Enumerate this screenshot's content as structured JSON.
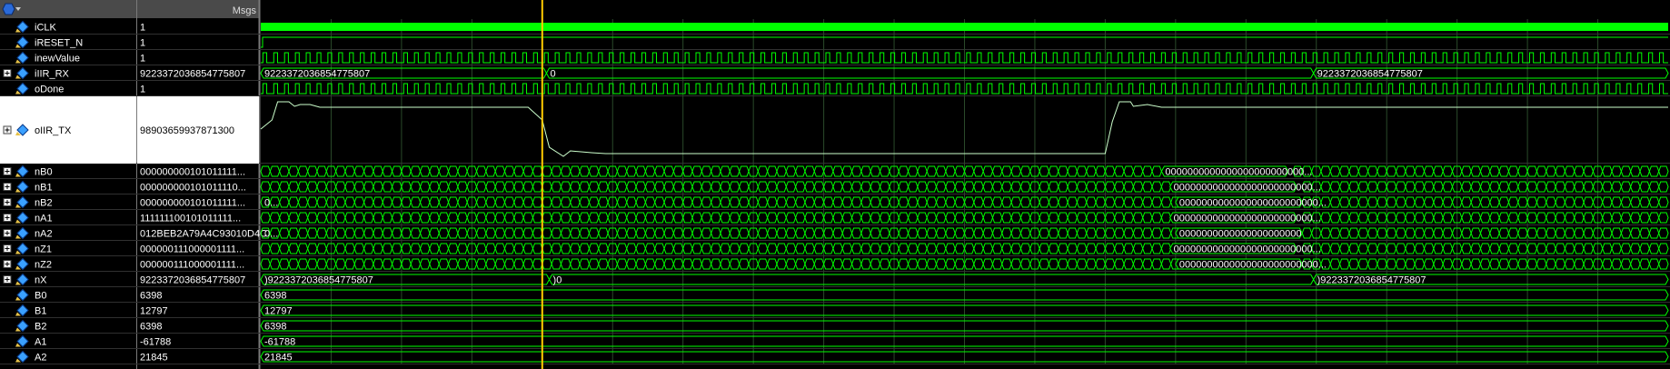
{
  "header": {
    "msgs_label": "Msgs"
  },
  "cursor_fraction": 0.2,
  "signals": [
    {
      "name": "iCLK",
      "value": "1",
      "type": "clock",
      "density": 190,
      "expand": false
    },
    {
      "name": "iRESET_N",
      "value": "1",
      "type": "high",
      "expand": false
    },
    {
      "name": "inewValue",
      "value": "1",
      "type": "pulses",
      "density": 130,
      "expand": false
    },
    {
      "name": "iIIR_RX",
      "value": "9223372036854775807",
      "type": "bus",
      "expand": true,
      "labels": [
        {
          "t": 0.0,
          "text": "9223372036854775807"
        },
        {
          "t": 0.203,
          "text": "0"
        },
        {
          "t": 0.748,
          "text": "9223372036854775807"
        }
      ],
      "transitions": [
        0.203,
        0.748
      ]
    },
    {
      "name": "oDone",
      "value": "1",
      "type": "pulses",
      "density": 130,
      "expand": false
    },
    {
      "name": "oIIR_TX",
      "value": "98903659937871300",
      "type": "analog",
      "expand": true
    },
    {
      "name": "nB0",
      "value": "000000000101011111...",
      "type": "bus",
      "dense": true,
      "expand": true,
      "labels": [
        {
          "t": 0.64,
          "text": "0000000000000000000000000..."
        }
      ]
    },
    {
      "name": "nB1",
      "value": "000000000101011110...",
      "type": "bus",
      "dense": true,
      "expand": true,
      "labels": [
        {
          "t": 0.646,
          "text": "0000000000000000000000000..."
        }
      ]
    },
    {
      "name": "nB2",
      "value": "000000000101011111...",
      "type": "bus",
      "dense": true,
      "expand": true,
      "labels": [
        {
          "t": 0.0,
          "text": "0..."
        },
        {
          "t": 0.65,
          "text": "0000000000000000000000000..."
        }
      ]
    },
    {
      "name": "nA1",
      "value": "111111100101011111...",
      "type": "bus",
      "dense": true,
      "expand": true,
      "labels": [
        {
          "t": 0.646,
          "text": "0000000000000000000000000..."
        }
      ]
    },
    {
      "name": "nA2",
      "value": "012BEB2A79A4C93010D4C",
      "type": "bus",
      "dense": true,
      "expand": true,
      "labels": [
        {
          "t": 0.0,
          "text": "0..."
        },
        {
          "t": 0.65,
          "text": "0000000000000000000000"
        }
      ]
    },
    {
      "name": "nZ1",
      "value": "000000111000001111...",
      "type": "bus",
      "dense": true,
      "expand": true,
      "labels": [
        {
          "t": 0.646,
          "text": "0000000000000000000000000..."
        }
      ]
    },
    {
      "name": "nZ2",
      "value": "000000111000001111...",
      "type": "bus",
      "dense": true,
      "expand": true,
      "labels": [
        {
          "t": 0.65,
          "text": "0000000000000000000000000..."
        }
      ]
    },
    {
      "name": "nX",
      "value": "9223372036854775807",
      "type": "bus",
      "expand": true,
      "labels": [
        {
          "t": 0.0,
          "text": ")9223372036854775807"
        },
        {
          "t": 0.205,
          "text": ")0"
        },
        {
          "t": 0.748,
          "text": ")9223372036854775807"
        }
      ],
      "transitions": [
        0.205,
        0.748
      ]
    },
    {
      "name": "B0",
      "value": "6398",
      "type": "bus",
      "expand": false,
      "labels": [
        {
          "t": 0.0,
          "text": "6398"
        }
      ]
    },
    {
      "name": "B1",
      "value": "12797",
      "type": "bus",
      "expand": false,
      "labels": [
        {
          "t": 0.0,
          "text": "12797"
        }
      ]
    },
    {
      "name": "B2",
      "value": "6398",
      "type": "bus",
      "expand": false,
      "labels": [
        {
          "t": 0.0,
          "text": "6398"
        }
      ]
    },
    {
      "name": "A1",
      "value": "-61788",
      "type": "bus",
      "expand": false,
      "labels": [
        {
          "t": 0.0,
          "text": "-61788"
        }
      ]
    },
    {
      "name": "A2",
      "value": "21845",
      "type": "bus",
      "expand": false,
      "labels": [
        {
          "t": 0.0,
          "text": "21845"
        }
      ]
    }
  ],
  "colors": {
    "wave": "#00ff00",
    "cursor": "#ffcc00",
    "grid": "#2a4a2a",
    "name_bg": "#000000",
    "divider": "#808080",
    "text": "#ffffff"
  }
}
